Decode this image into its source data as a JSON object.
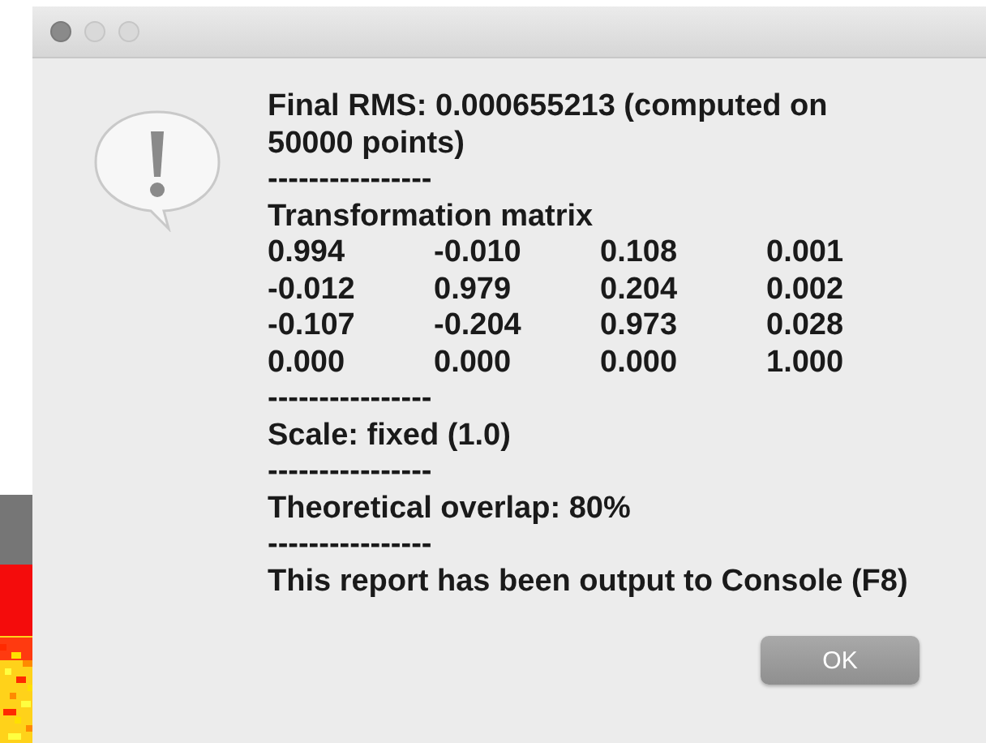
{
  "dialog": {
    "lines": [
      {
        "kind": "text",
        "text": "Final RMS: 0.000655213 (computed on 50000 points)"
      },
      {
        "kind": "rule",
        "text": "----------------"
      },
      {
        "kind": "text",
        "text": "Transformation matrix"
      },
      {
        "kind": "row",
        "cells": [
          "0.994",
          "-0.010",
          "0.108",
          "0.001"
        ]
      },
      {
        "kind": "row",
        "cells": [
          "-0.012",
          "0.979",
          "0.204",
          "0.002"
        ]
      },
      {
        "kind": "row",
        "cells": [
          "-0.107",
          "-0.204",
          "0.973",
          "0.028"
        ]
      },
      {
        "kind": "row",
        "cells": [
          "0.000",
          "0.000",
          "0.000",
          "1.000"
        ]
      },
      {
        "kind": "rule",
        "text": "----------------"
      },
      {
        "kind": "text",
        "text": "Scale: fixed (1.0)"
      },
      {
        "kind": "rule",
        "text": "----------------"
      },
      {
        "kind": "text",
        "text": "Theoretical overlap: 80%"
      },
      {
        "kind": "rule",
        "text": "----------------"
      },
      {
        "kind": "text",
        "text": "This report has been output to Console (F8)"
      }
    ],
    "buttons": [
      {
        "label": "OK"
      }
    ]
  }
}
